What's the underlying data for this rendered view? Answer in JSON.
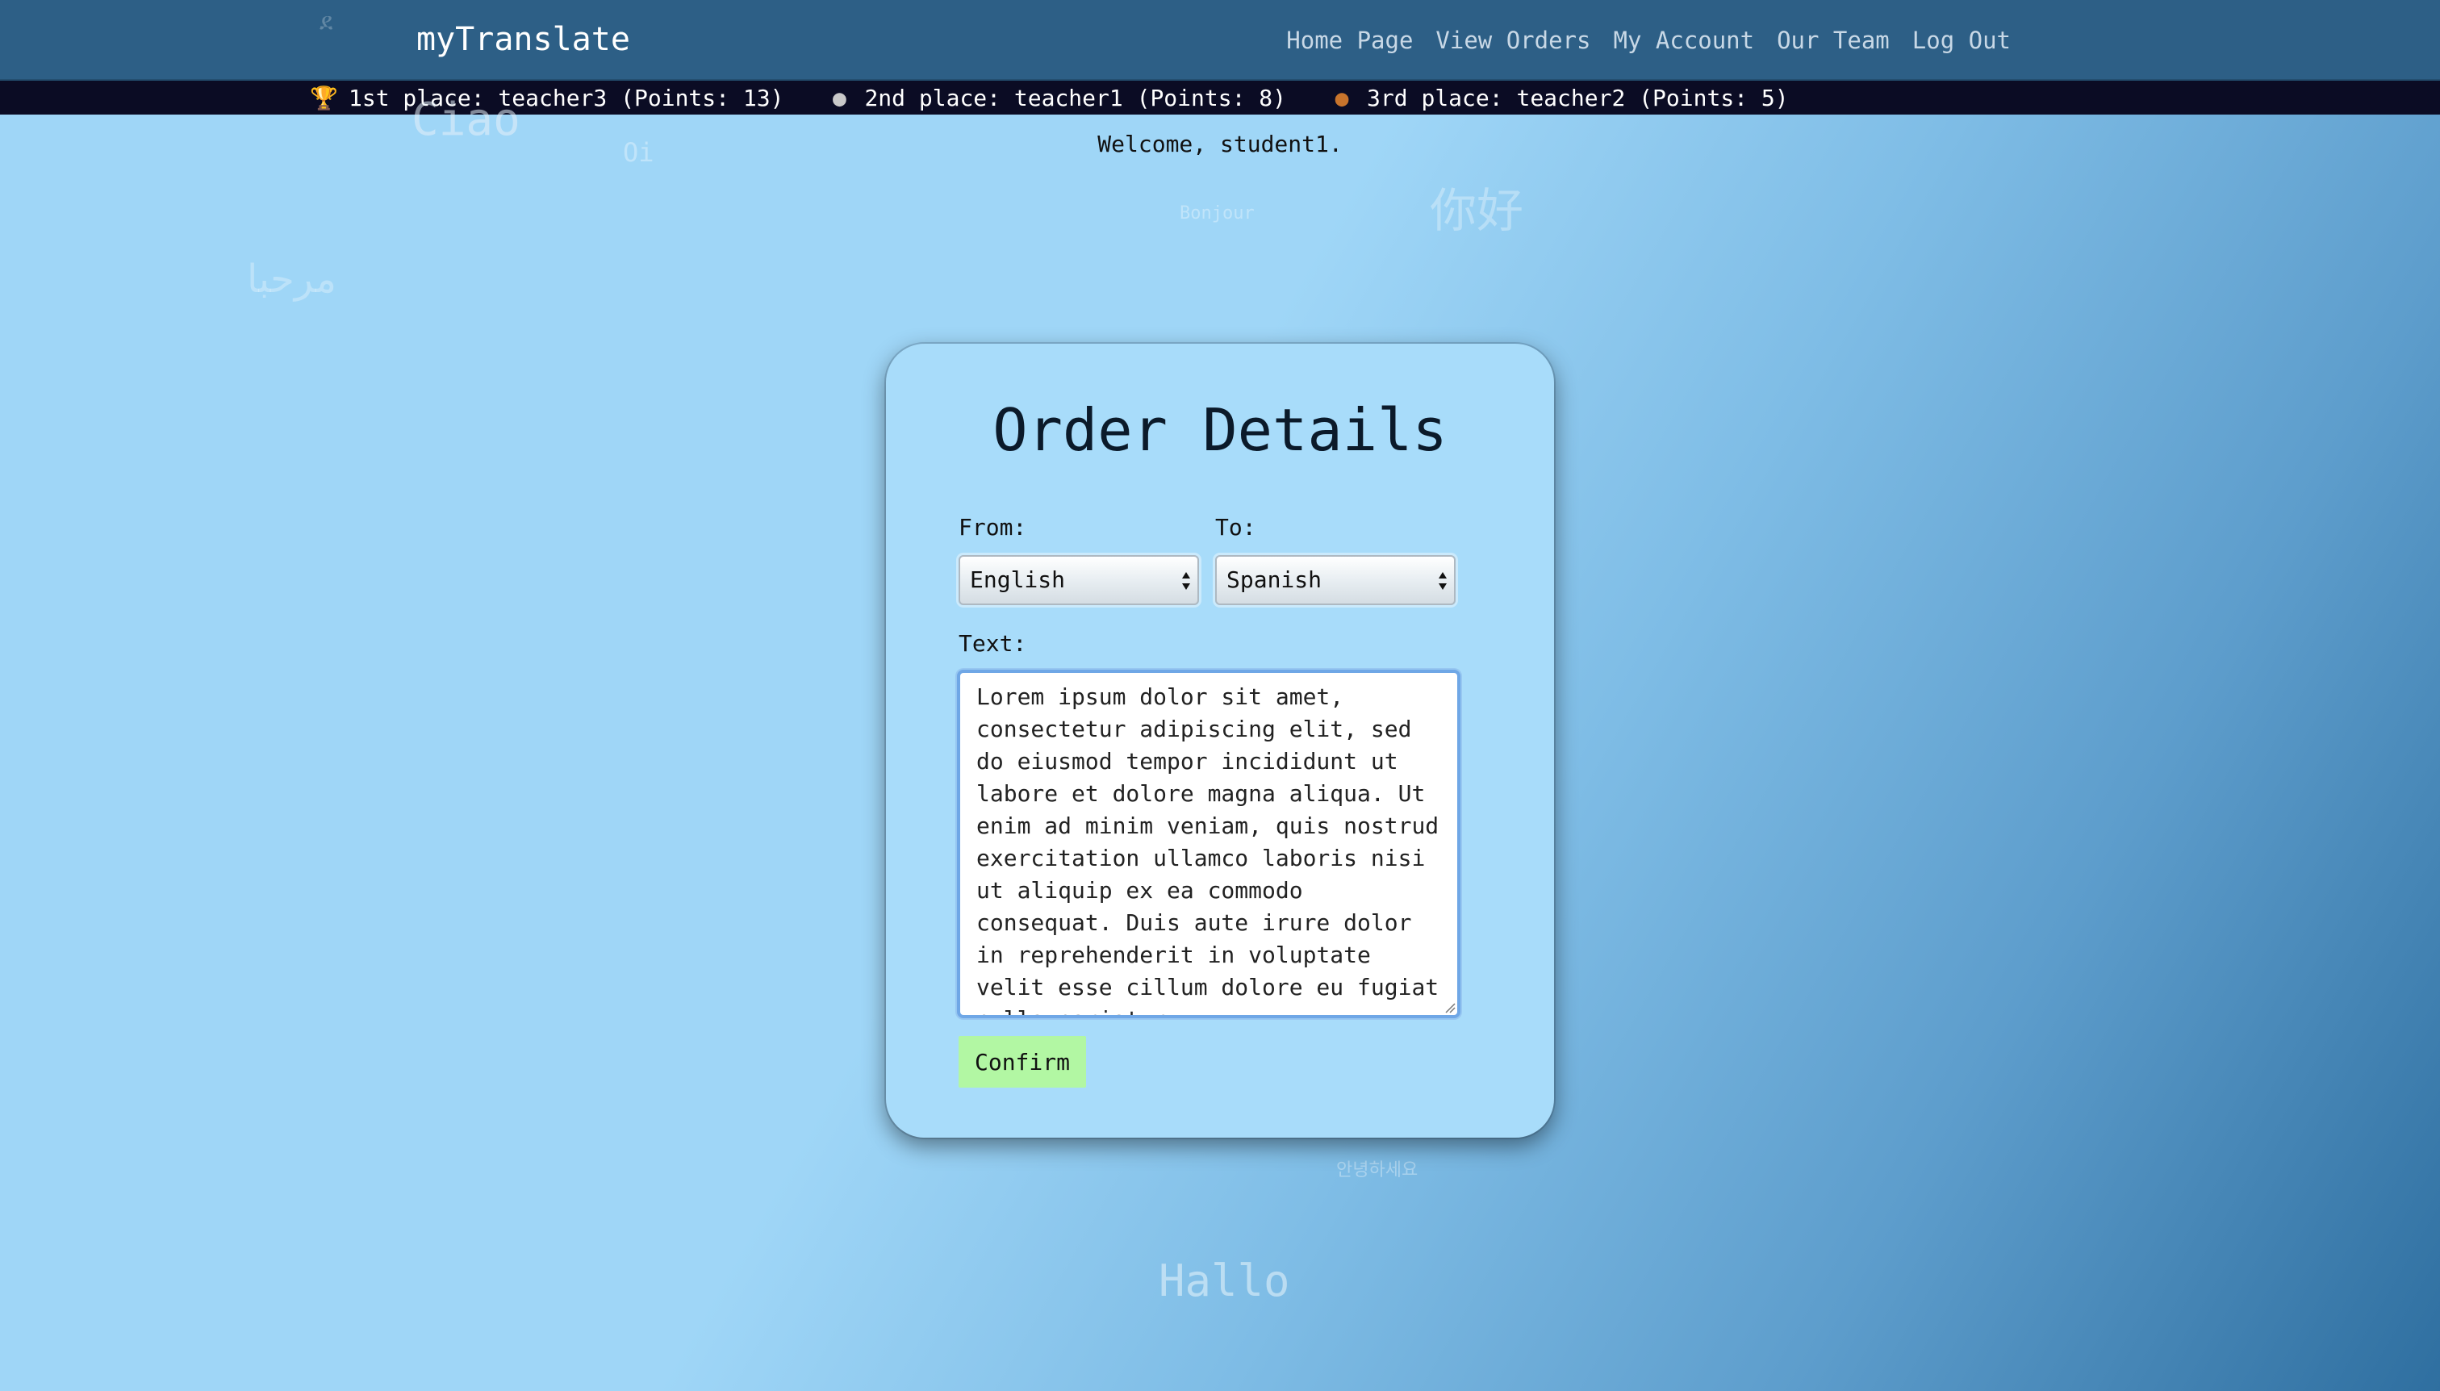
{
  "navbar": {
    "brand": "myTranslate",
    "links": [
      {
        "label": "Home Page"
      },
      {
        "label": "View Orders"
      },
      {
        "label": "My Account"
      },
      {
        "label": "Our Team"
      },
      {
        "label": "Log Out"
      }
    ]
  },
  "leaderboard": [
    {
      "icon": "trophy-icon",
      "text": "1st place: teacher3 (Points: 13)"
    },
    {
      "icon": "silver-medal-icon",
      "text": "2nd place: teacher1 (Points: 8)"
    },
    {
      "icon": "bronze-medal-icon",
      "text": "3rd place: teacher2 (Points: 5)"
    }
  ],
  "welcome": "Welcome, student1.",
  "background_words": {
    "ciao": "Ciao",
    "oi": "Oi",
    "bonjour": "Bonjour",
    "nihao": "你好",
    "marhaba": "مرحبا",
    "annyeong": "안녕하세요",
    "hallo": "Hallo"
  },
  "form": {
    "title": "Order Details",
    "from_label": "From:",
    "to_label": "To:",
    "from_value": "English",
    "to_value": "Spanish",
    "text_label": "Text:",
    "text_value": "Lorem ipsum dolor sit amet, consectetur adipiscing elit, sed do eiusmod tempor incididunt ut labore et dolore magna aliqua. Ut enim ad minim veniam, quis nostrud exercitation ullamco laboris nisi ut aliquip ex ea commodo consequat. Duis aute irure dolor in reprehenderit in voluptate velit esse cillum dolore eu fugiat nulla pariatur.",
    "confirm_label": "Confirm"
  },
  "colors": {
    "navbar": "#2d5f86",
    "leaderboard": "#0b0c24",
    "card": "#a8dcfa",
    "confirm_button": "#b2f7a3",
    "textarea_focus_border": "#6fa7e6"
  }
}
